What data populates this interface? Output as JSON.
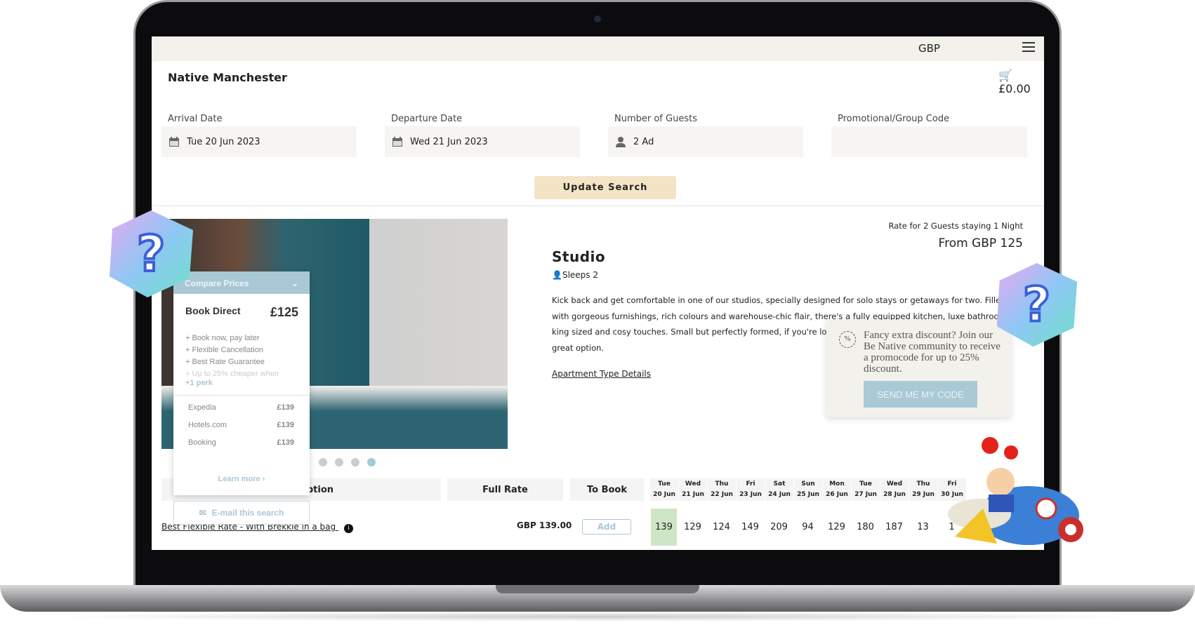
{
  "header": {
    "currency": "GBP",
    "property_name": "Native Manchester",
    "cart_total": "£0.00"
  },
  "search": {
    "arrival_label": "Arrival Date",
    "arrival_value": "Tue 20 Jun 2023",
    "departure_label": "Departure Date",
    "departure_value": "Wed 21 Jun 2023",
    "guests_label": "Number of Guests",
    "guests_value": "2 Ad",
    "promo_label": "Promotional/Group Code",
    "promo_value": "",
    "update_label": "Update Search"
  },
  "room": {
    "name": "Studio",
    "sleeps": "Sleeps 2",
    "rate_for": "Rate for 2 Guests staying 1 Night",
    "from_price": "From GBP 125",
    "description": "Kick back and get comfortable in one of our studios, specially designed for solo stays or getaways for two. Filled with gorgeous furnishings, rich colours and warehouse-chic flair, there's a fully equipped kitchen, luxe bathroom, king sized and cosy touches. Small but perfectly formed, if you're looking for a stylis",
    "description_end": "great option.",
    "details_link": "Apartment Type Details",
    "carousel_active_dot": 5
  },
  "compare": {
    "title": "Compare Prices",
    "book_direct": "Book Direct",
    "direct_price": "£125",
    "perks": [
      "+ Book now, pay later",
      "+ Flexible Cancellation",
      "+ Best Rate Guarantee",
      "+ Up to 25% cheaper when"
    ],
    "more_perks": "+1 perk",
    "otas": [
      {
        "name": "Expedia",
        "price": "£139"
      },
      {
        "name": "Hotels.com",
        "price": "£139"
      },
      {
        "name": "Booking",
        "price": "£139"
      }
    ],
    "learn_more": "Learn more ›",
    "email_label": "E-mail this search"
  },
  "promo_popup": {
    "text": "Fancy extra discount? Join our Be Native community to receive a promocode for up to 25% discount.",
    "button": "SEND ME MY CODE"
  },
  "table": {
    "headers": {
      "description": "ription",
      "full_rate": "Full Rate",
      "to_book": "To Book"
    },
    "dates": [
      {
        "day": "Tue",
        "date": "20 Jun"
      },
      {
        "day": "Wed",
        "date": "21 Jun"
      },
      {
        "day": "Thu",
        "date": "22 Jun"
      },
      {
        "day": "Fri",
        "date": "23 Jun"
      },
      {
        "day": "Sat",
        "date": "24 Jun"
      },
      {
        "day": "Sun",
        "date": "25 Jun"
      },
      {
        "day": "Mon",
        "date": "26 Jun"
      },
      {
        "day": "Tue",
        "date": "27 Jun"
      },
      {
        "day": "Wed",
        "date": "28 Jun"
      },
      {
        "day": "Thu",
        "date": "29 Jun"
      },
      {
        "day": "Fri",
        "date": "30 Jun"
      }
    ],
    "rows": [
      {
        "name": "Best Flexible Rate - With Brekkie in a bag",
        "full_rate": "GBP 139.00",
        "add_label": "Add",
        "prices": [
          "139",
          "129",
          "124",
          "149",
          "209",
          "94",
          "129",
          "180",
          "187",
          "13",
          "1"
        ]
      }
    ],
    "selected_color": "#cfe6c6"
  },
  "colors": {
    "accent": "#a9c9d6",
    "update_button": "#f3e4c5",
    "topbar": "#f3f1ec"
  }
}
